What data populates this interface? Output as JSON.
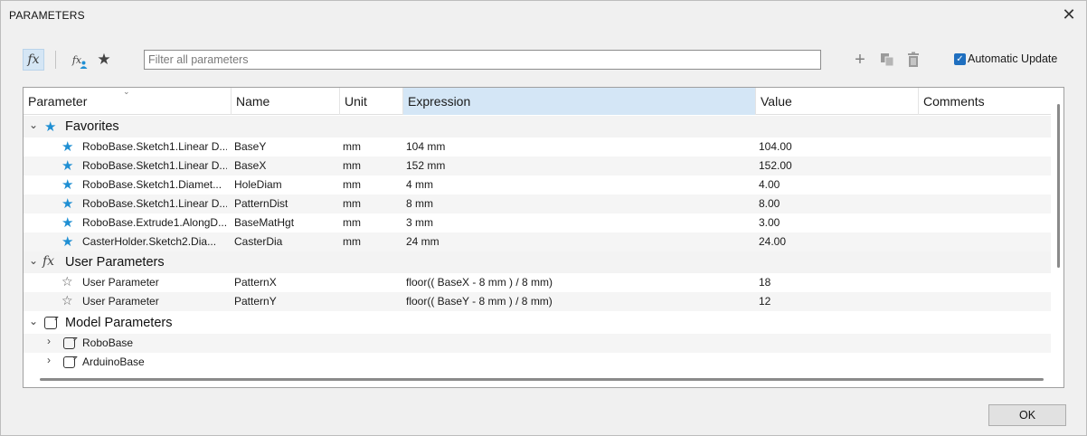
{
  "window": {
    "title": "PARAMETERS",
    "close_glyph": "✕"
  },
  "toolbar": {
    "fx_icon": "fx-icon",
    "fx_label": "fx",
    "fx_user_label": "fx",
    "star_glyph": "★",
    "filter_placeholder": "Filter all parameters",
    "filter_value": "",
    "plus_glyph": "+",
    "auto_update_label": "Automatic Update",
    "auto_update_checked": true
  },
  "table": {
    "columns": [
      "Parameter",
      "Name",
      "Unit",
      "Expression",
      "Value",
      "Comments"
    ],
    "active_column": "Expression",
    "groups": {
      "favorites": {
        "label": "Favorites",
        "rows": [
          {
            "parameter": "RoboBase.Sketch1.Linear D...",
            "name": "BaseY",
            "unit": "mm",
            "expression": "104 mm",
            "value": "104.00",
            "comments": ""
          },
          {
            "parameter": "RoboBase.Sketch1.Linear D...",
            "name": "BaseX",
            "unit": "mm",
            "expression": "152 mm",
            "value": "152.00",
            "comments": ""
          },
          {
            "parameter": "RoboBase.Sketch1.Diamet...",
            "name": "HoleDiam",
            "unit": "mm",
            "expression": "4 mm",
            "value": "4.00",
            "comments": ""
          },
          {
            "parameter": "RoboBase.Sketch1.Linear D...",
            "name": "PatternDist",
            "unit": "mm",
            "expression": "8 mm",
            "value": "8.00",
            "comments": ""
          },
          {
            "parameter": "RoboBase.Extrude1.AlongD...",
            "name": "BaseMatHgt",
            "unit": "mm",
            "expression": "3 mm",
            "value": "3.00",
            "comments": ""
          },
          {
            "parameter": "CasterHolder.Sketch2.Dia...",
            "name": "CasterDia",
            "unit": "mm",
            "expression": "24 mm",
            "value": "24.00",
            "comments": ""
          }
        ]
      },
      "user": {
        "label": "User Parameters",
        "icon_label": "fx",
        "rows": [
          {
            "parameter": "User Parameter",
            "name": "PatternX",
            "unit": "",
            "expression": "floor(( BaseX - 8 mm ) / 8 mm)",
            "value": "18",
            "comments": ""
          },
          {
            "parameter": "User Parameter",
            "name": "PatternY",
            "unit": "",
            "expression": "floor(( BaseY - 8 mm ) / 8 mm)",
            "value": "12",
            "comments": ""
          }
        ]
      },
      "model": {
        "label": "Model Parameters",
        "children": [
          "RoboBase",
          "ArduinoBase"
        ]
      }
    }
  },
  "footer": {
    "ok_label": "OK"
  },
  "colors": {
    "accent": "#1f8fd3",
    "header_active": "#d4e6f6",
    "checkbox": "#1f6fbf"
  }
}
